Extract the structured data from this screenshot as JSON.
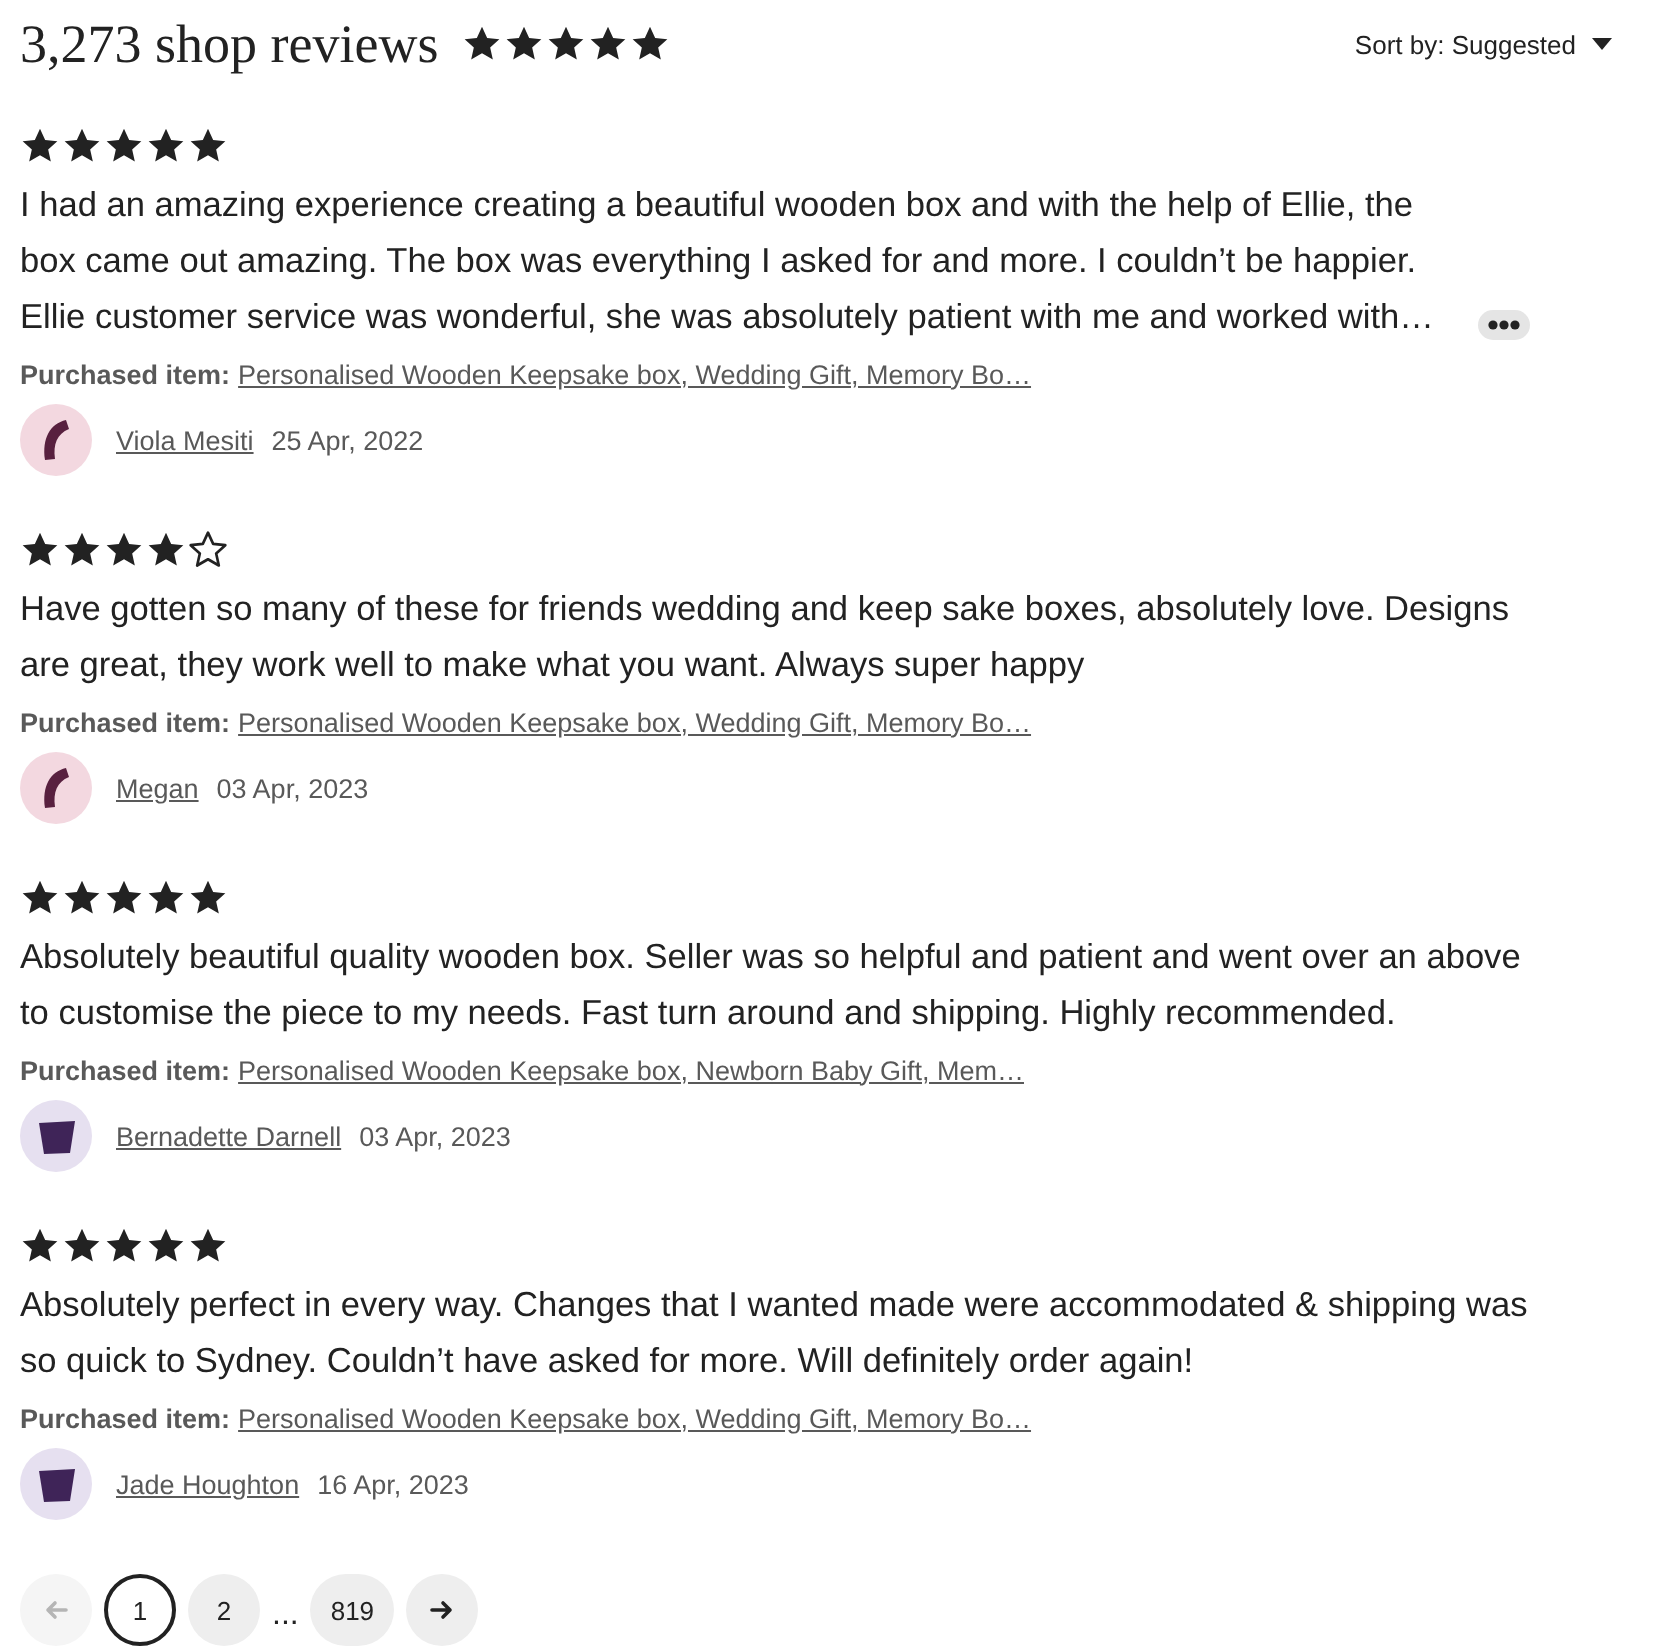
{
  "header": {
    "title": "3,273 shop reviews",
    "stars": 5,
    "sort": {
      "label": "Sort by: Suggested"
    }
  },
  "reviews": [
    {
      "kind": "crescent",
      "stars": 5,
      "text": "I had an amazing experience creating a beautiful wooden box and with the help of Ellie, the box came out amazing. The box was everything I asked for and more. I couldn’t be happier. Ellie customer service was wonderful, she was absolutely patient with me and worked with…",
      "more": true,
      "purchased": {
        "label": "Purchased item:",
        "item": "Personalised Wooden Keepsake box, Wedding Gift, Memory Bo…"
      },
      "reviewer": {
        "name": "Viola Mesiti",
        "date": "25 Apr, 2022"
      }
    },
    {
      "kind": "crescent",
      "stars": 4,
      "text": "Have gotten so many of these for friends wedding and keep sake boxes, absolutely love. Designs are great, they work well to make what you want. Always super happy",
      "more": false,
      "purchased": {
        "label": "Purchased item:",
        "item": "Personalised Wooden Keepsake box, Wedding Gift, Memory Bo…"
      },
      "reviewer": {
        "name": "Megan",
        "date": "03 Apr, 2023"
      }
    },
    {
      "kind": "trapezoid",
      "stars": 5,
      "text": "Absolutely beautiful quality wooden box. Seller was so helpful and patient and went over an above to customise the piece to my needs. Fast turn around and shipping. Highly recommended.",
      "more": false,
      "purchased": {
        "label": "Purchased item:",
        "item": "Personalised Wooden Keepsake box, Newborn Baby Gift, Mem…"
      },
      "reviewer": {
        "name": "Bernadette Darnell",
        "date": "03 Apr, 2023"
      }
    },
    {
      "kind": "trapezoid",
      "stars": 5,
      "text": "Absolutely perfect in every way. Changes that I wanted made were accommodated & shipping was so quick to Sydney. Couldn’t have asked for more. Will definitely order again!",
      "more": false,
      "purchased": {
        "label": "Purchased item:",
        "item": "Personalised Wooden Keepsake box, Wedding Gift, Memory Bo…"
      },
      "reviewer": {
        "name": "Jade Houghton",
        "date": "16 Apr, 2023"
      }
    }
  ],
  "pagination": {
    "previous": {
      "disabled": true
    },
    "pages": [
      {
        "kind": "page",
        "label": "1",
        "selected": true
      },
      {
        "kind": "page",
        "label": "2",
        "selected": false
      },
      {
        "kind": "gap",
        "label": "..."
      },
      {
        "kind": "page",
        "label": "819",
        "selected": false
      }
    ],
    "next": {
      "disabled": false
    }
  }
}
